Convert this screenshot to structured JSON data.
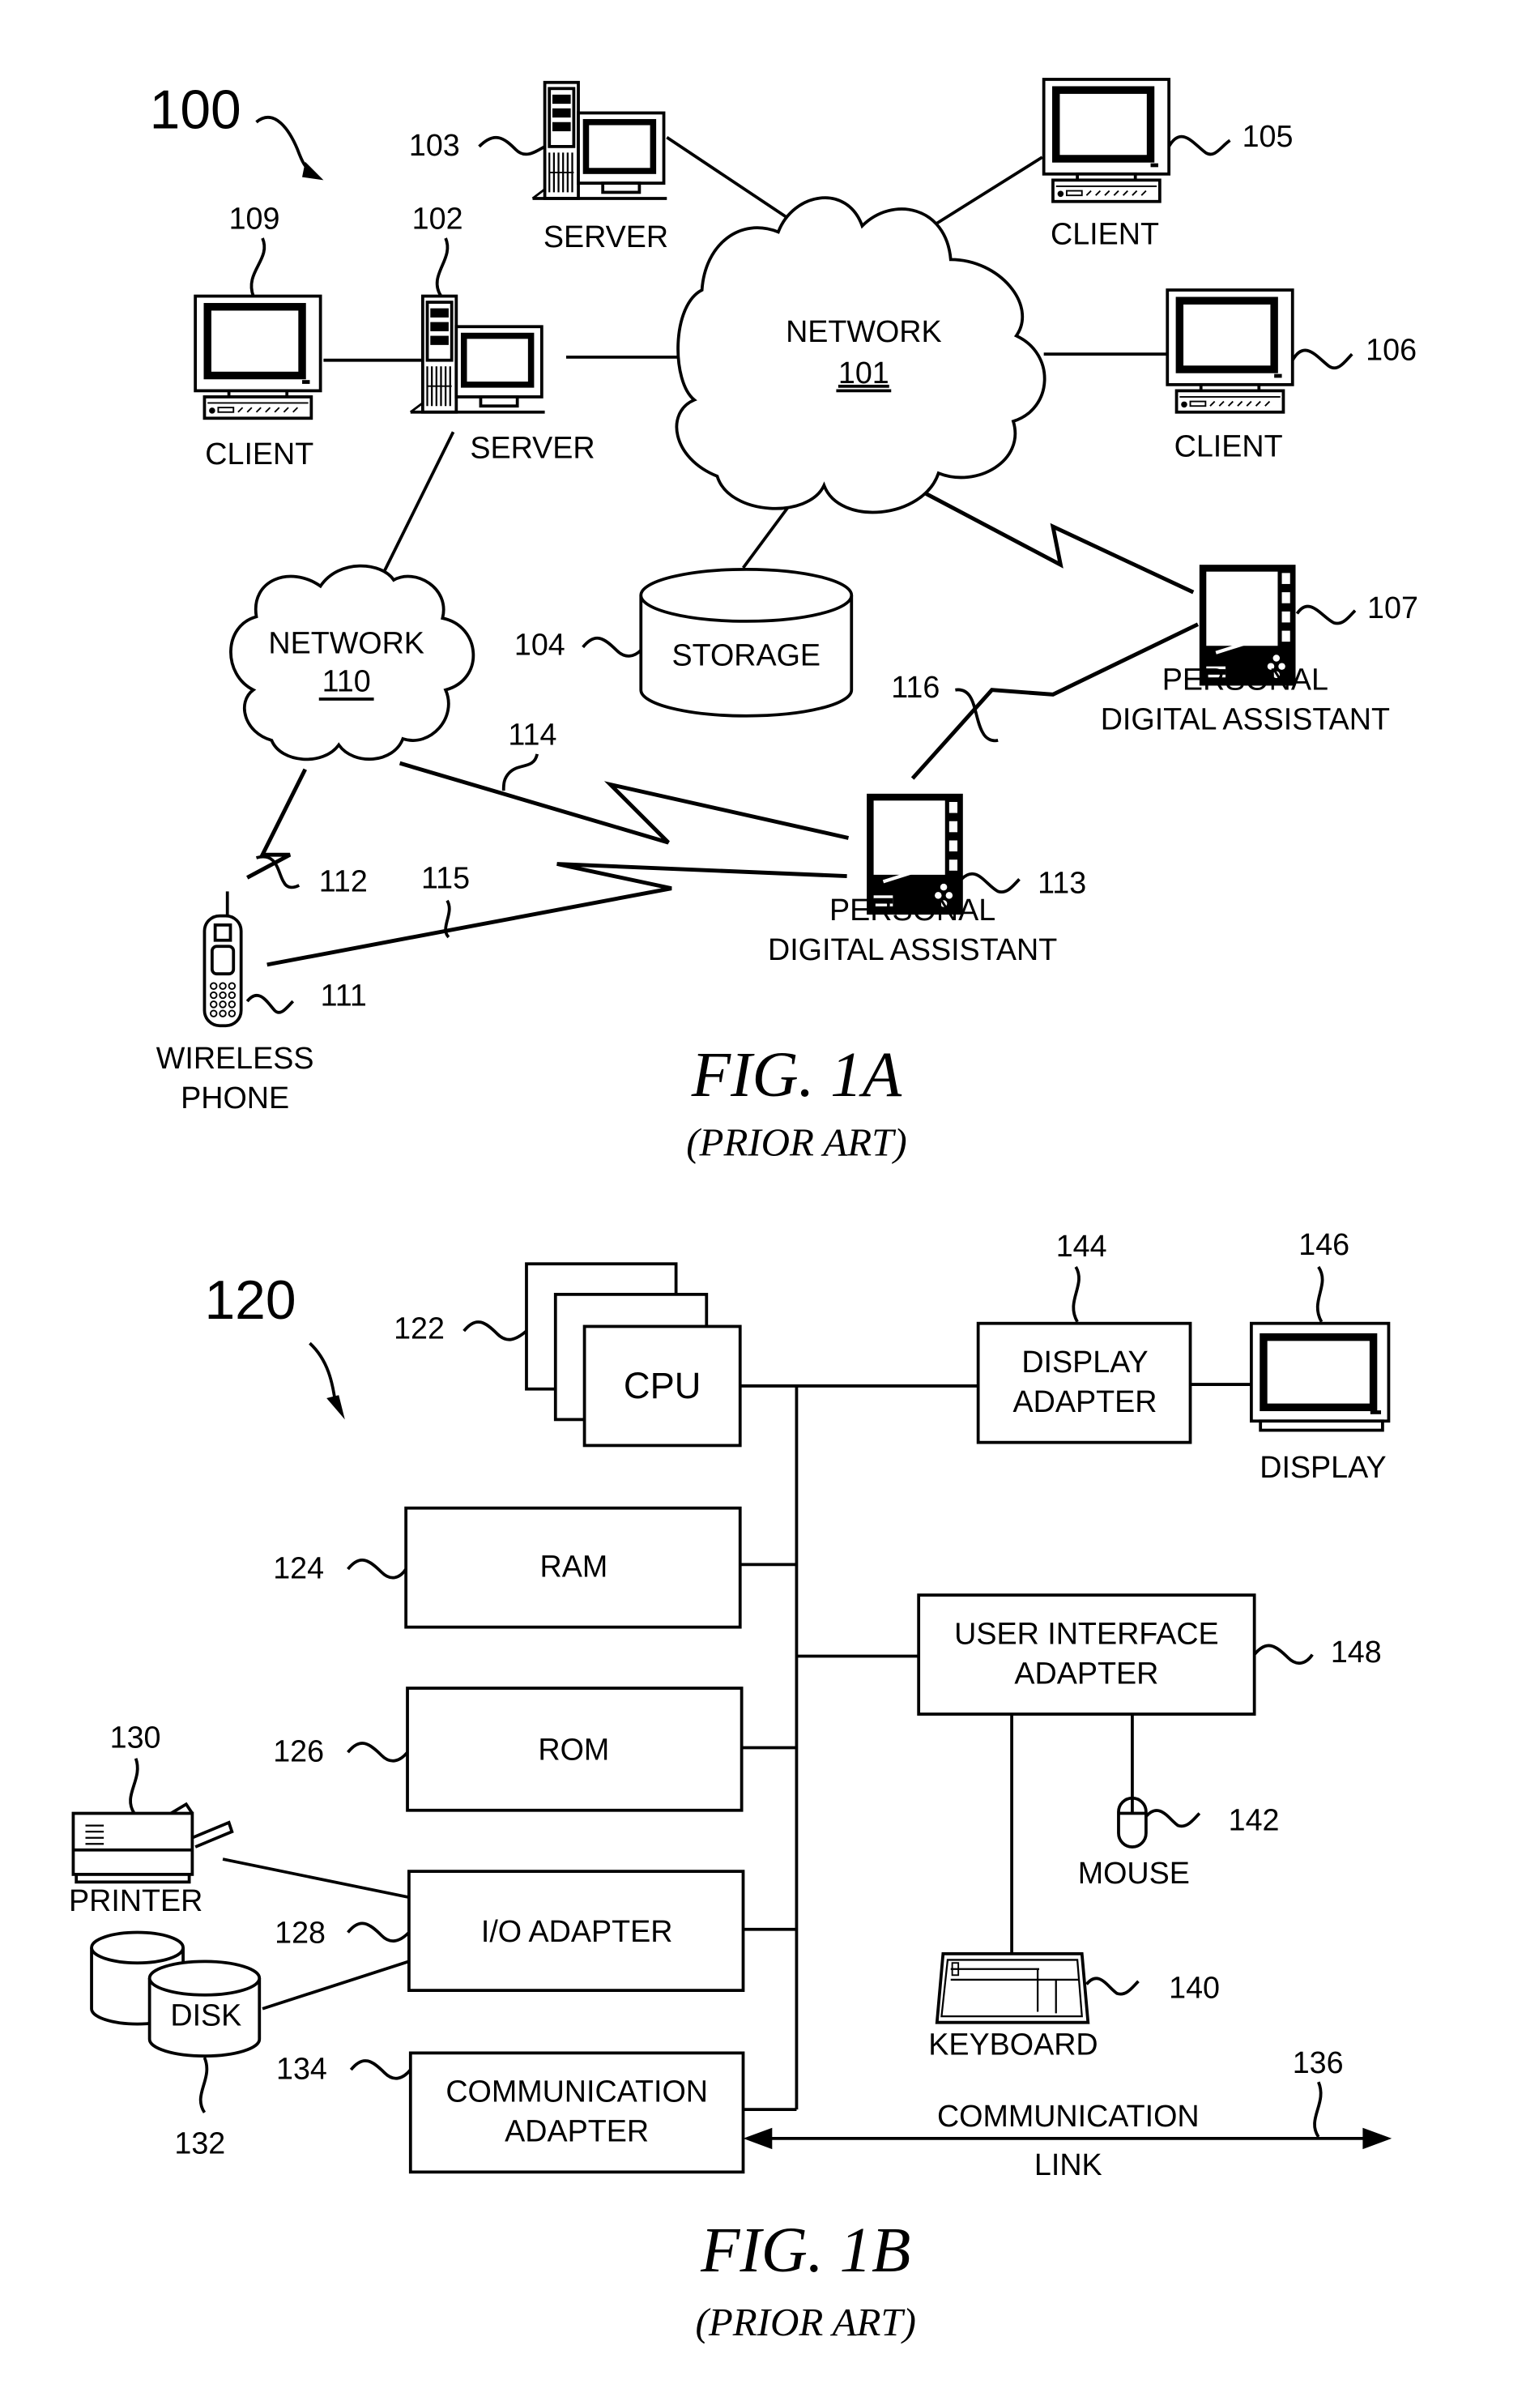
{
  "fig1a": {
    "system_ref": "100",
    "network_101": {
      "label": "NETWORK",
      "ref": "101"
    },
    "network_110": {
      "label": "NETWORK",
      "ref": "110"
    },
    "server_103": {
      "label": "SERVER",
      "ref": "103"
    },
    "server_102": {
      "label": "SERVER",
      "ref": "102"
    },
    "client_109": {
      "label": "CLIENT",
      "ref": "109"
    },
    "client_105": {
      "label": "CLIENT",
      "ref": "105"
    },
    "client_106": {
      "label": "CLIENT",
      "ref": "106"
    },
    "storage_104": {
      "label": "STORAGE",
      "ref": "104"
    },
    "pda_107": {
      "label_line1": "PERSONAL",
      "label_line2": "DIGITAL ASSISTANT",
      "ref": "107"
    },
    "pda_113": {
      "label_line1": "PERSONAL",
      "label_line2": "DIGITAL ASSISTANT",
      "ref": "113"
    },
    "phone_111": {
      "label_line1": "WIRELESS",
      "label_line2": "PHONE",
      "ref": "111"
    },
    "links": {
      "l112": "112",
      "l114": "114",
      "l115": "115",
      "l116": "116"
    },
    "caption": "FIG. 1A",
    "subcaption": "(PRIOR ART)"
  },
  "fig1b": {
    "system_ref": "120",
    "cpu": {
      "label": "CPU",
      "ref": "122"
    },
    "ram": {
      "label": "RAM",
      "ref": "124"
    },
    "rom": {
      "label": "ROM",
      "ref": "126"
    },
    "io_adapter": {
      "label": "I/O ADAPTER",
      "ref": "128"
    },
    "printer": {
      "label": "PRINTER",
      "ref": "130"
    },
    "disk": {
      "label": "DISK",
      "ref": "132"
    },
    "comm_adapter": {
      "label_line1": "COMMUNICATION",
      "label_line2": "ADAPTER",
      "ref": "134"
    },
    "comm_link": {
      "label_line1": "COMMUNICATION",
      "label_line2": "LINK",
      "ref": "136"
    },
    "keyboard": {
      "label": "KEYBOARD",
      "ref": "140"
    },
    "mouse": {
      "label": "MOUSE",
      "ref": "142"
    },
    "display_adapter": {
      "label_line1": "DISPLAY",
      "label_line2": "ADAPTER",
      "ref": "144"
    },
    "display": {
      "label": "DISPLAY",
      "ref": "146"
    },
    "ui_adapter": {
      "label_line1": "USER INTERFACE",
      "label_line2": "ADAPTER",
      "ref": "148"
    },
    "caption": "FIG. 1B",
    "subcaption": "(PRIOR ART)"
  }
}
